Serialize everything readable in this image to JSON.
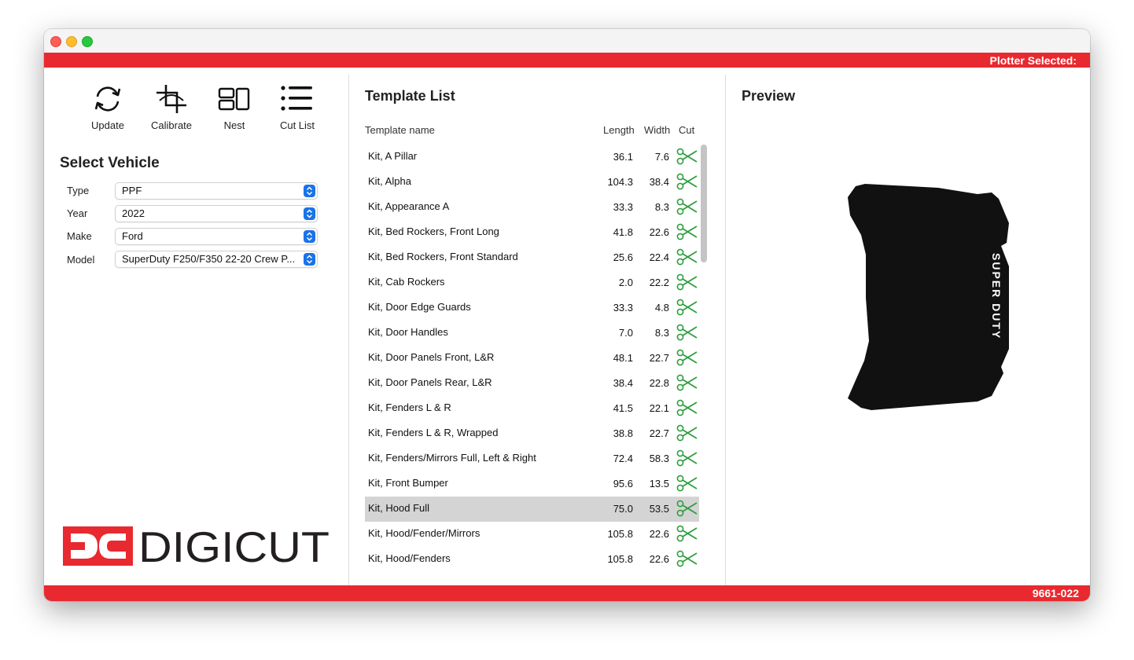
{
  "window": {
    "controls": [
      "close",
      "minimize",
      "zoom"
    ]
  },
  "header": {
    "status_text": "Plotter Selected:"
  },
  "toolbar": [
    {
      "label": "Update",
      "icon": "refresh-icon"
    },
    {
      "label": "Calibrate",
      "icon": "crop-icon"
    },
    {
      "label": "Nest",
      "icon": "nest-icon"
    },
    {
      "label": "Cut List",
      "icon": "list-icon"
    }
  ],
  "vehicle": {
    "title": "Select Vehicle",
    "fields": [
      {
        "label": "Type",
        "value": "PPF"
      },
      {
        "label": "Year",
        "value": "2022"
      },
      {
        "label": "Make",
        "value": "Ford"
      },
      {
        "label": "Model",
        "value": "SuperDuty F250/F350 22-20 Crew P..."
      }
    ]
  },
  "brand": {
    "logo_mark": "DC",
    "logo_text": "DIGICUT",
    "colors": {
      "red": "#e8292f",
      "dark": "#231f20"
    }
  },
  "templates": {
    "title": "Template List",
    "columns": {
      "name": "Template name",
      "length": "Length",
      "width": "Width",
      "cut": "Cut"
    },
    "selected_index": 14,
    "rows": [
      {
        "name": "Kit, A Pillar",
        "length": "36.1",
        "width": "7.6"
      },
      {
        "name": "Kit, Alpha",
        "length": "104.3",
        "width": "38.4"
      },
      {
        "name": "Kit, Appearance A",
        "length": "33.3",
        "width": "8.3"
      },
      {
        "name": "Kit, Bed Rockers, Front Long",
        "length": "41.8",
        "width": "22.6"
      },
      {
        "name": "Kit, Bed Rockers, Front Standard",
        "length": "25.6",
        "width": "22.4"
      },
      {
        "name": "Kit, Cab Rockers",
        "length": "2.0",
        "width": "22.2"
      },
      {
        "name": "Kit, Door Edge Guards",
        "length": "33.3",
        "width": "4.8"
      },
      {
        "name": "Kit, Door Handles",
        "length": "7.0",
        "width": "8.3"
      },
      {
        "name": "Kit, Door Panels Front, L&R",
        "length": "48.1",
        "width": "22.7"
      },
      {
        "name": "Kit, Door Panels Rear, L&R",
        "length": "38.4",
        "width": "22.8"
      },
      {
        "name": "Kit, Fenders L & R",
        "length": "41.5",
        "width": "22.1"
      },
      {
        "name": "Kit, Fenders L & R, Wrapped",
        "length": "38.8",
        "width": "22.7"
      },
      {
        "name": "Kit, Fenders/Mirrors Full, Left & Right",
        "length": "72.4",
        "width": "58.3"
      },
      {
        "name": "Kit, Front Bumper",
        "length": "95.6",
        "width": "13.5"
      },
      {
        "name": "Kit, Hood Full",
        "length": "75.0",
        "width": "53.5"
      },
      {
        "name": "Kit, Hood/Fender/Mirrors",
        "length": "105.8",
        "width": "22.6"
      },
      {
        "name": "Kit, Hood/Fenders",
        "length": "105.8",
        "width": "22.6"
      }
    ],
    "cut_icon_color": "#2e9e3e"
  },
  "preview": {
    "title": "Preview",
    "shape_text": "SUPER DUTY"
  },
  "footer": {
    "code": "9661-022"
  }
}
